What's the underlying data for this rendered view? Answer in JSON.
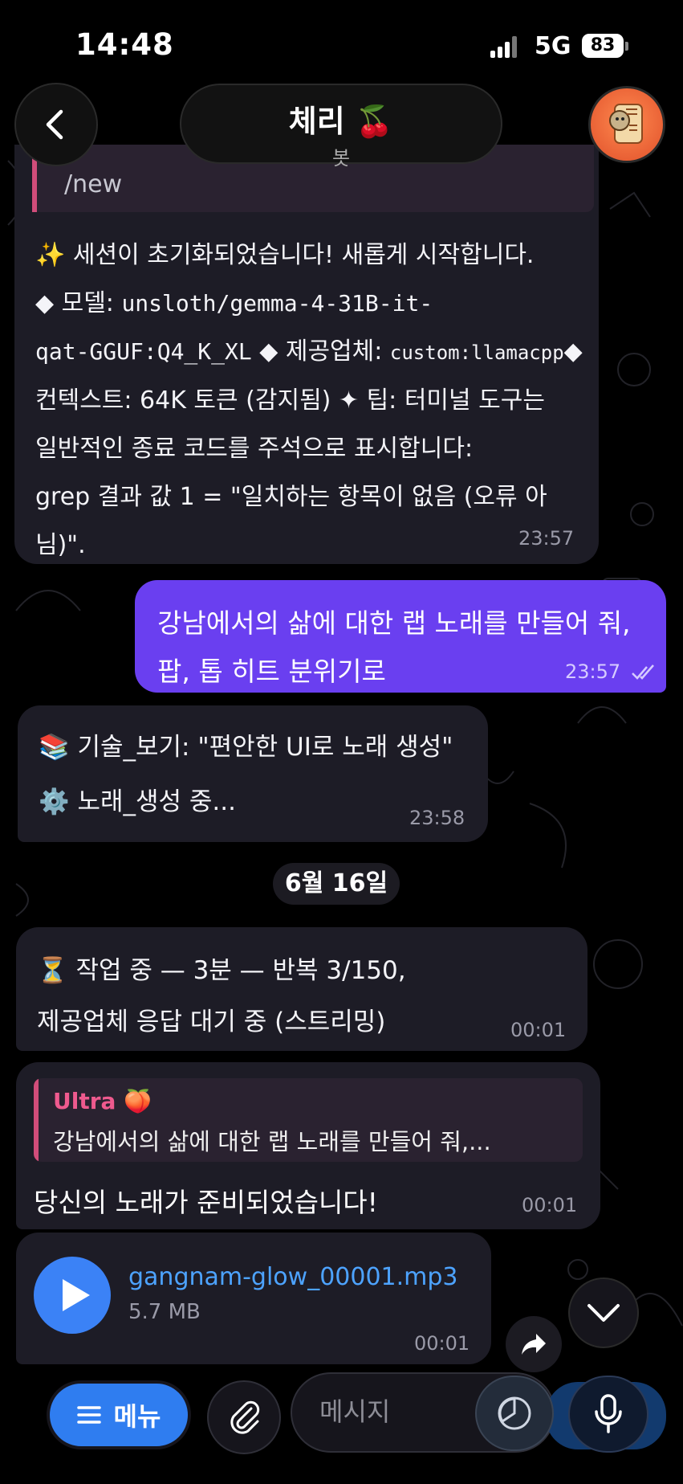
{
  "status_bar": {
    "time": "14:48",
    "network": "5G",
    "battery": "83"
  },
  "header": {
    "title": "체리 🍒",
    "subtitle": "봇"
  },
  "messages": [
    {
      "direction": "in",
      "quote": "/new",
      "lines": [
        "✨ 세션이 초기화되었습니다! 새롭게 시작합니다.",
        "◆ 모델: ",
        "unsloth/gemma-4-31B-it-",
        "qat-GGUF:Q4_K_XL",
        " ◆ 제공업체: ",
        "custom:llamacpp",
        "◆",
        "컨텍스트: 64K 토큰 (감지됨) ✦ 팁: 터미널 도구는",
        "일반적인 종료 코드를 주석으로 표시합니다:",
        "grep 결과 값 1 = \"일치하는 항목이 없음 (오류 아님)\"."
      ],
      "time": "23:57"
    },
    {
      "direction": "out",
      "text": "강남에서의 삶에 대한 랩 노래를 만들어 줘, 팝, 톱 히트 분위기로",
      "time": "23:57"
    },
    {
      "direction": "in",
      "line1": "📚 기술_보기: \"편안한 UI로 노래 생성\"",
      "line2": "⚙️ 노래_생성 중...",
      "time": "23:58"
    },
    {
      "direction": "in",
      "line1": "⏳ 작업 중 — 3분 — 반복 3/150,",
      "line2": "제공업체 응답 대기 중 (스트리밍)",
      "time": "00:01"
    },
    {
      "direction": "in",
      "reply_author": "Ultra 🍑",
      "reply_text": "강남에서의 삶에 대한 랩 노래를 만들어 줘,...",
      "text": "당신의 노래가 준비되었습니다!",
      "time": "00:01"
    },
    {
      "direction": "in",
      "file_name": "gangnam-glow_00001.mp3",
      "file_size": "5.7 MB",
      "time": "00:01"
    }
  ],
  "date_separator": "6월 16일",
  "composer": {
    "menu_label": "메뉴",
    "placeholder": "메시지"
  },
  "colors": {
    "accent": "#6a3ff0",
    "link": "#4da3ff",
    "menu": "#2f7df0",
    "quote_bar": "#d14d7a"
  },
  "icons": [
    "back-icon",
    "avatar-icon",
    "play-icon",
    "share-icon",
    "chevron-down-icon",
    "menu-icon",
    "paperclip-icon",
    "timer-icon",
    "microphone-icon",
    "double-check-icon"
  ]
}
